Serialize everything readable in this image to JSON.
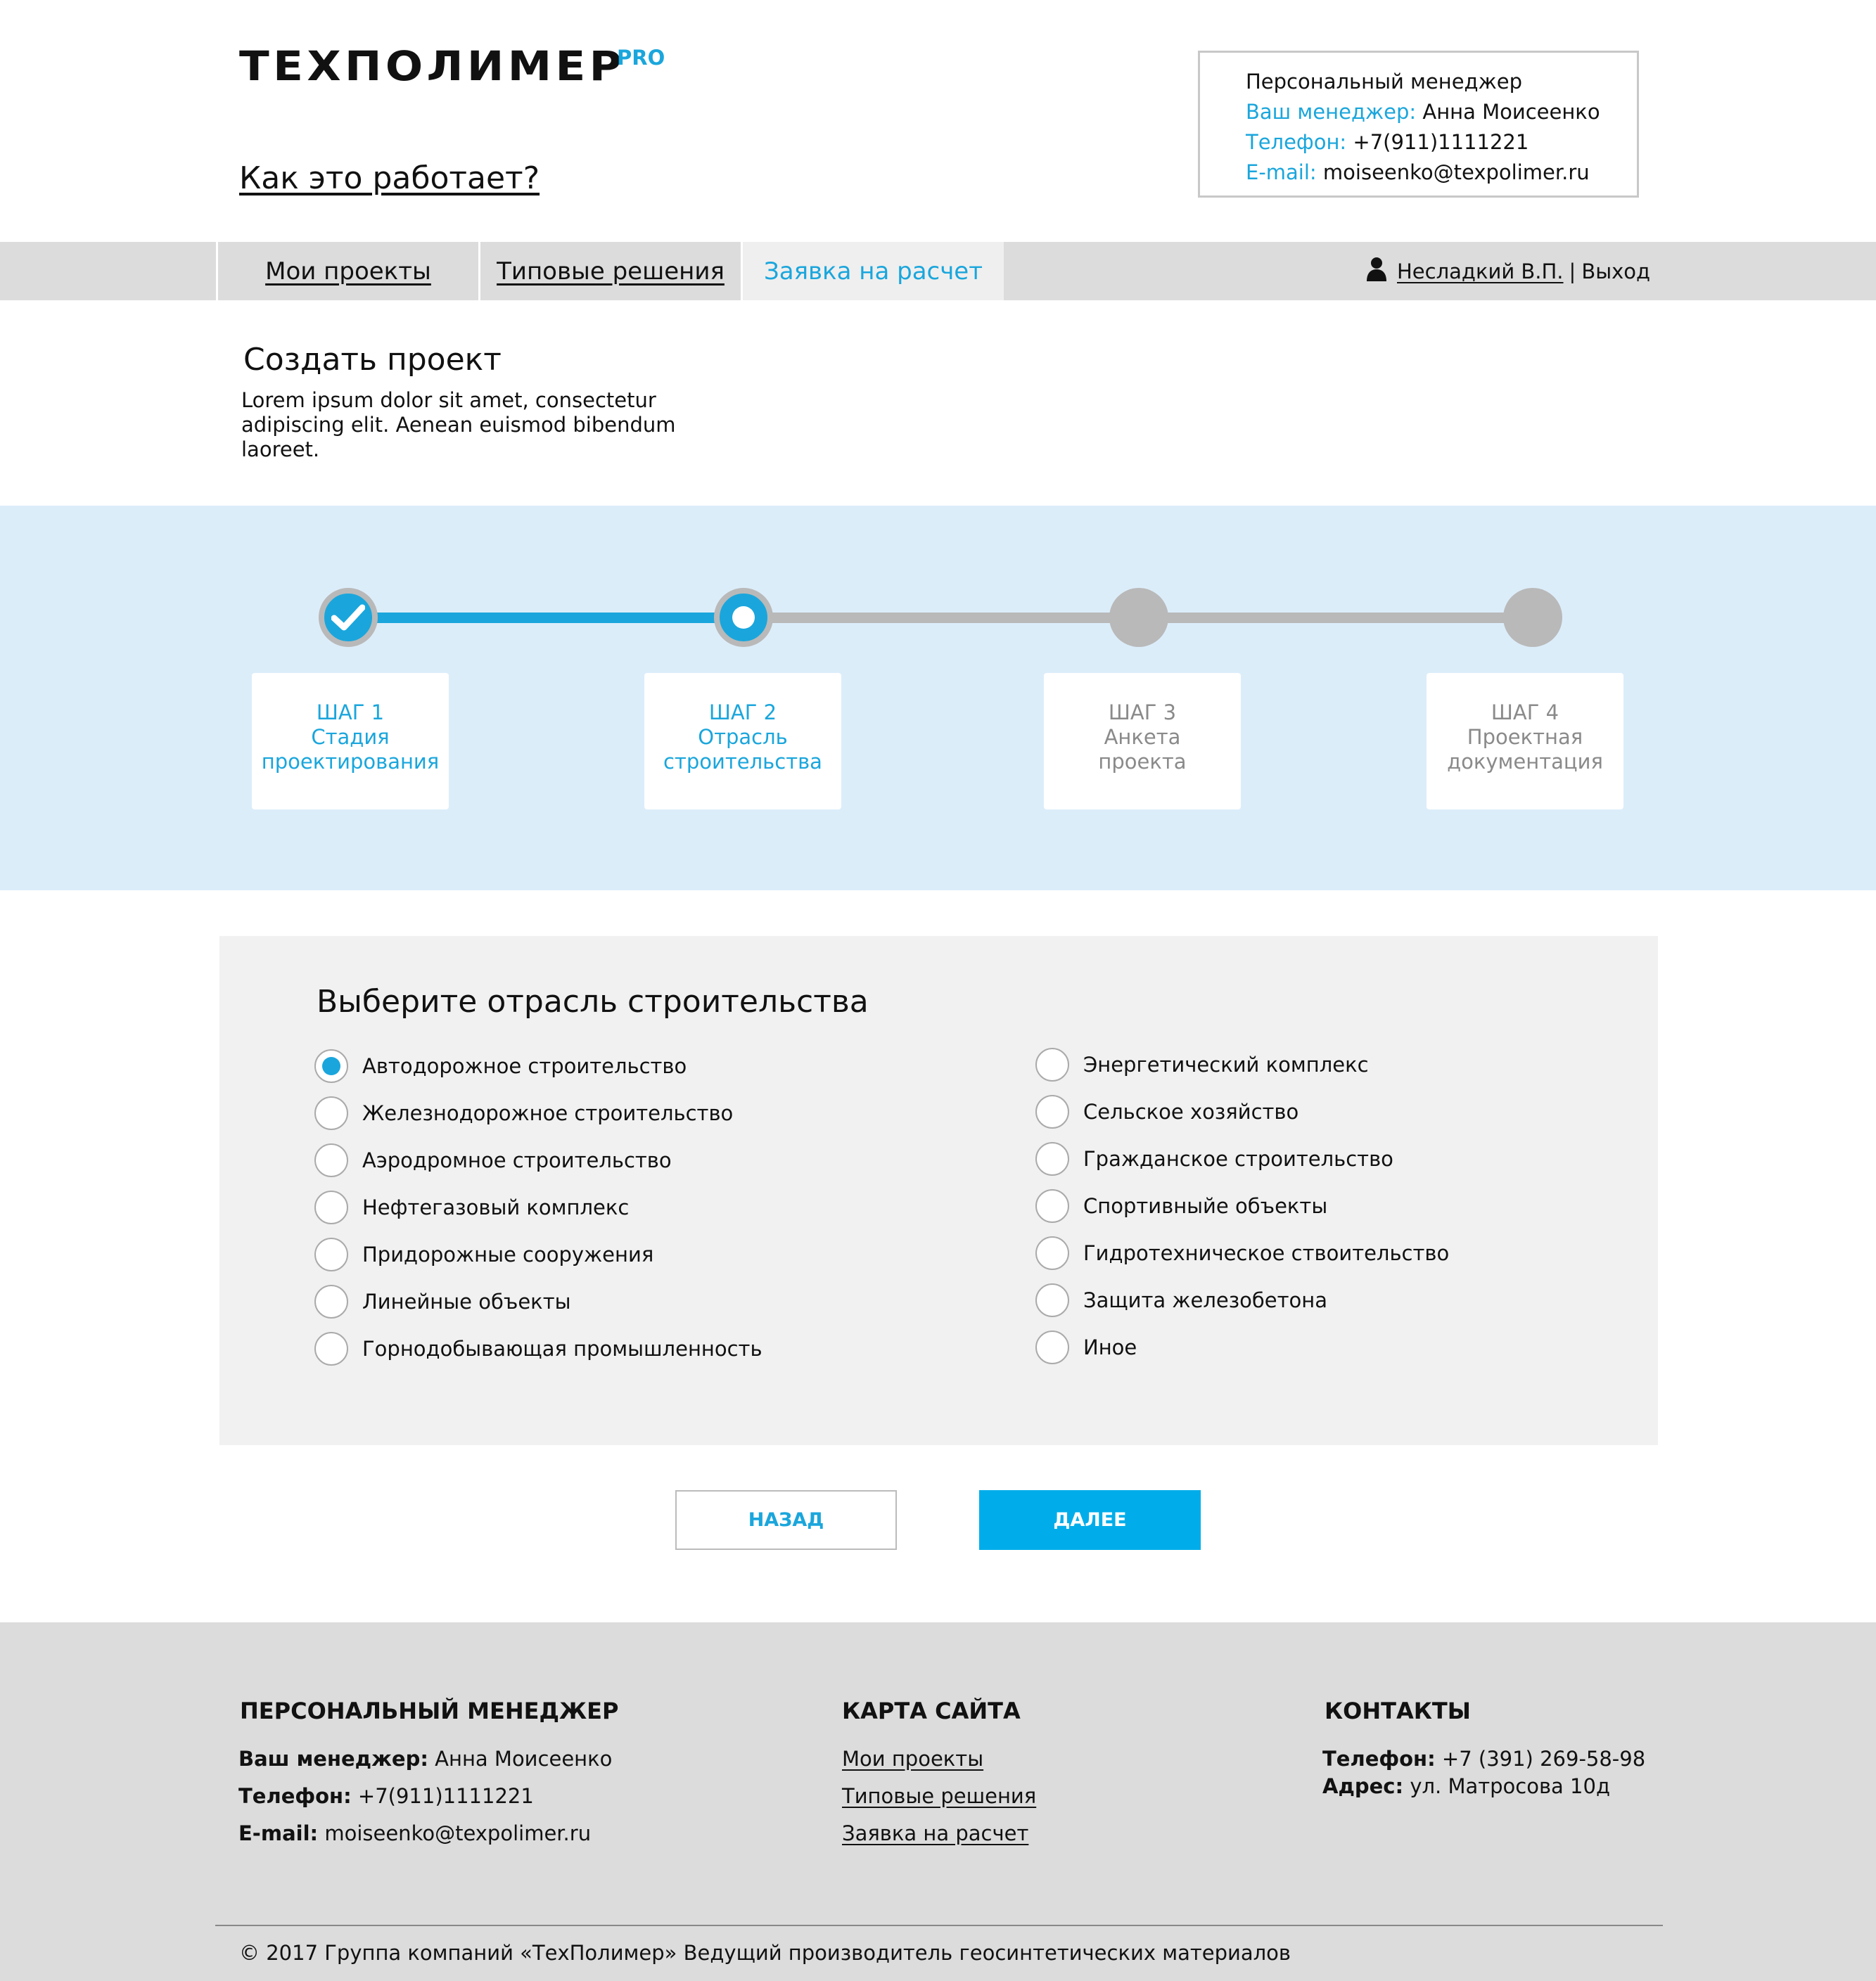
{
  "header": {
    "logo_text": "ТЕХПОЛИМЕР",
    "logo_suffix": "PRO",
    "how_link": "Как это работает?",
    "manager_box": {
      "title": "Персональный менеджер",
      "manager_label": "Ваш менеджер:",
      "manager_name": "Анна Моисеенко",
      "phone_label": "Телефон:",
      "phone": "+7(911)1111221",
      "email_label": "E-mail:",
      "email": "moiseenko@texpolimer.ru"
    }
  },
  "nav": {
    "tabs": [
      {
        "label": "Мои проекты",
        "active": false
      },
      {
        "label": "Типовые решения",
        "active": false
      },
      {
        "label": "Заявка на расчет",
        "active": true
      }
    ],
    "user_name": "Несладкий В.П.",
    "separator": "|",
    "logout": "Выход"
  },
  "intro": {
    "title": "Создать проект",
    "description": "Lorem ipsum dolor sit amet, consectetur adipiscing elit. Aenean euismod bibendum laoreet."
  },
  "stepper": {
    "current_step": 2,
    "steps": [
      {
        "num": "ШАГ 1",
        "line1": "Стадия",
        "line2": "проектирования",
        "state": "done"
      },
      {
        "num": "ШАГ 2",
        "line1": "Отрасль",
        "line2": "строительства",
        "state": "current"
      },
      {
        "num": "ШАГ 3",
        "line1": "Анкета",
        "line2": "проекта",
        "state": "pending"
      },
      {
        "num": "ШАГ 4",
        "line1": "Проектная",
        "line2": "документация",
        "state": "pending"
      }
    ],
    "colors": {
      "active": "#1aa6dc",
      "inactive": "#b9b9b9"
    }
  },
  "form": {
    "title": "Выберите отрасль строительства",
    "selected": "Автодорожное строительство",
    "left_options": [
      "Автодорожное строительство",
      "Железнодорожное строительство",
      "Аэродромное строительство",
      "Нефтегазовый комплекс",
      "Придорожные сооружения",
      "Линейные объекты",
      "Горнодобывающая промышленность"
    ],
    "right_options": [
      "Энергетический комплекс",
      "Сельское хозяйство",
      "Гражданское строительство",
      "Спортивныйе объекты",
      "Гидротехническое ствоительство",
      "Защита железобетона",
      "Иное"
    ]
  },
  "buttons": {
    "back": "НАЗАД",
    "next": "ДАЛЕЕ"
  },
  "footer": {
    "manager": {
      "heading": "ПЕРСОНАЛЬНЫЙ МЕНЕДЖЕР",
      "manager_label": "Ваш менеджер:",
      "manager_name": "Анна Моисеенко",
      "phone_label": "Телефон:",
      "phone": "+7(911)1111221",
      "email_label": "E-mail:",
      "email": "moiseenko@texpolimer.ru"
    },
    "sitemap": {
      "heading": "КАРТА САЙТА",
      "links": [
        "Мои проекты",
        "Типовые решения",
        "Заявка на расчет"
      ]
    },
    "contacts": {
      "heading": "КОНТАКТЫ",
      "phone_label": "Телефон:",
      "phone": "+7 (391) 269-58-98",
      "address_label": "Адрес:",
      "address": "ул. Матросова 10д"
    },
    "copyright": "© 2017 Группа компаний «ТехПолимер» Ведущий производитель геосинтетических материалов"
  }
}
